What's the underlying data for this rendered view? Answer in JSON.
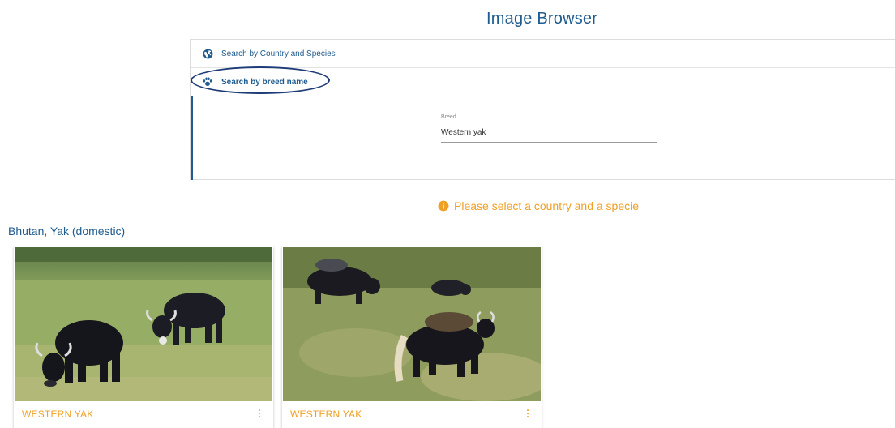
{
  "page": {
    "title": "Image Browser"
  },
  "accordion": {
    "items": [
      {
        "label": "Search by Country and Species",
        "icon": "globe-icon"
      },
      {
        "label": "Search by breed name",
        "icon": "paw-icon"
      }
    ],
    "breed_field": {
      "label": "Breed",
      "value": "Western yak"
    }
  },
  "alert": {
    "message": "Please select a country and a specie",
    "icon": "info-icon",
    "color": "#f0a024"
  },
  "results": {
    "section_title": "Bhutan, Yak (domestic)",
    "cards": [
      {
        "caption": "WESTERN YAK",
        "menu_icon": "more-vertical-icon"
      },
      {
        "caption": "WESTERN YAK",
        "menu_icon": "more-vertical-icon"
      }
    ]
  },
  "colors": {
    "primary": "#1f5b8e",
    "accent": "#f0a024"
  }
}
